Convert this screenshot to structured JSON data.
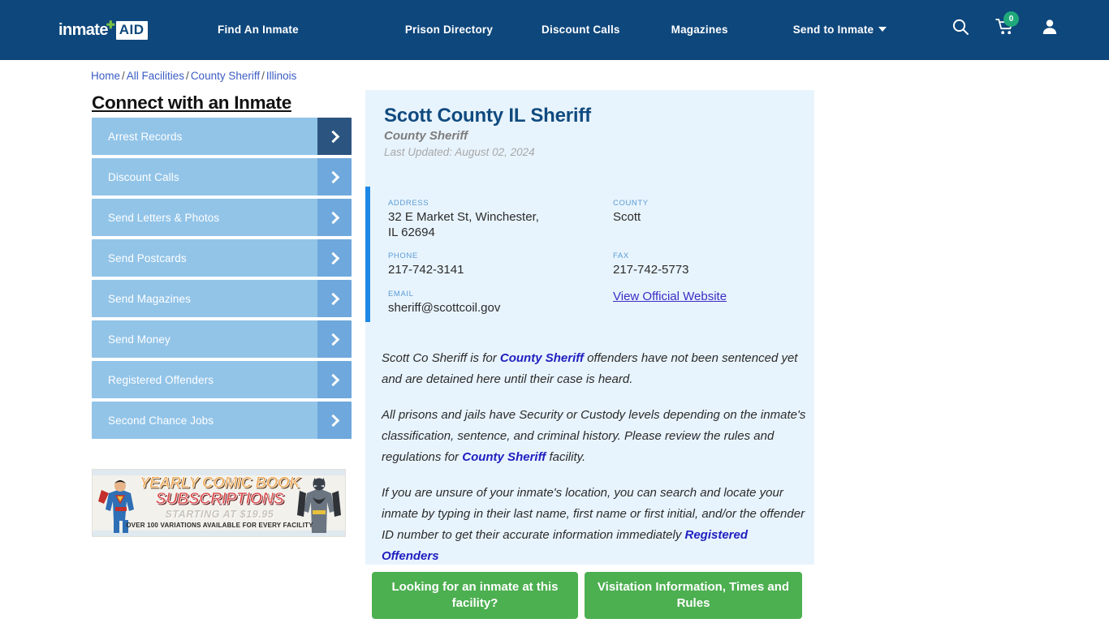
{
  "header": {
    "logo": {
      "word": "inmate",
      "plus": "✚",
      "aid": "AID"
    },
    "nav": [
      {
        "label": "Find An Inmate"
      },
      {
        "label": "Prison Directory"
      },
      {
        "label": "Discount Calls"
      },
      {
        "label": "Magazines"
      },
      {
        "label": "Send to Inmate",
        "has_caret": true
      }
    ],
    "icons": {
      "search": "search-icon",
      "cart": "cart-icon",
      "cart_count": "0",
      "account": "user-icon"
    },
    "bg_color": "#0e477c",
    "badge_color": "#1fa97a"
  },
  "breadcrumb": {
    "items": [
      "Home",
      "All Facilities",
      "County Sheriff",
      "Illinois"
    ],
    "separator": "/"
  },
  "sidebar": {
    "title": "Connect with an Inmate",
    "items": [
      {
        "label": "Arrest Records",
        "active": true
      },
      {
        "label": "Discount Calls",
        "active": false
      },
      {
        "label": "Send Letters & Photos",
        "active": false
      },
      {
        "label": "Send Postcards",
        "active": false
      },
      {
        "label": "Send Magazines",
        "active": false
      },
      {
        "label": "Send Money",
        "active": false
      },
      {
        "label": "Registered Offenders",
        "active": false
      },
      {
        "label": "Second Chance Jobs",
        "active": false
      }
    ],
    "button_color": "#92c4e8",
    "arrow_color": "#6ea8dc",
    "arrow_active_color": "#2c5480"
  },
  "ad": {
    "line1": "YEARLY COMIC BOOK",
    "line2": "SUBSCRIPTIONS",
    "line3": "STARTING AT $19.95",
    "line4": "OVER 100 VARIATIONS AVAILABLE FOR EVERY FACILITY"
  },
  "facility": {
    "title": "Scott County IL Sheriff",
    "subtitle": "County Sheriff",
    "last_updated": "Last Updated: August 02, 2024",
    "fields": {
      "address_label": "ADDRESS",
      "address_value": "32 E Market St, Winchester,\nIL 62694",
      "address_line1": "32 E Market St, Winchester,",
      "address_line2": "IL 62694",
      "county_label": "COUNTY",
      "county_value": "Scott",
      "phone_label": "PHONE",
      "phone_value": "217-742-3141",
      "fax_label": "FAX",
      "fax_value": "217-742-5773",
      "email_label": "EMAIL",
      "email_value": "sheriff@scottcoil.gov",
      "website_link": "View Official Website"
    },
    "accent_bar_color": "#1e88e5",
    "card_bg": "#e8f4fd"
  },
  "description": {
    "p1_a": "Scott Co Sheriff is for ",
    "p1_link": "County Sheriff",
    "p1_b": " offenders have not been sentenced yet and are detained here until their case is heard.",
    "p2_a": "All prisons and jails have Security or Custody levels depending on the inmate's classification, sentence, and criminal history. Please review the rules and regulations for ",
    "p2_link": "County Sheriff",
    "p2_b": " facility.",
    "p3_a": "If you are unsure of your inmate's location, you can search and locate your inmate by typing in their last name, first name or first initial, and/or the offender ID number to get their accurate information immediately ",
    "p3_link": "Registered Offenders"
  },
  "cta": {
    "button1": "Looking for an inmate at this facility?",
    "button2": "Visitation Information, Times and Rules",
    "color": "#4caf50"
  }
}
